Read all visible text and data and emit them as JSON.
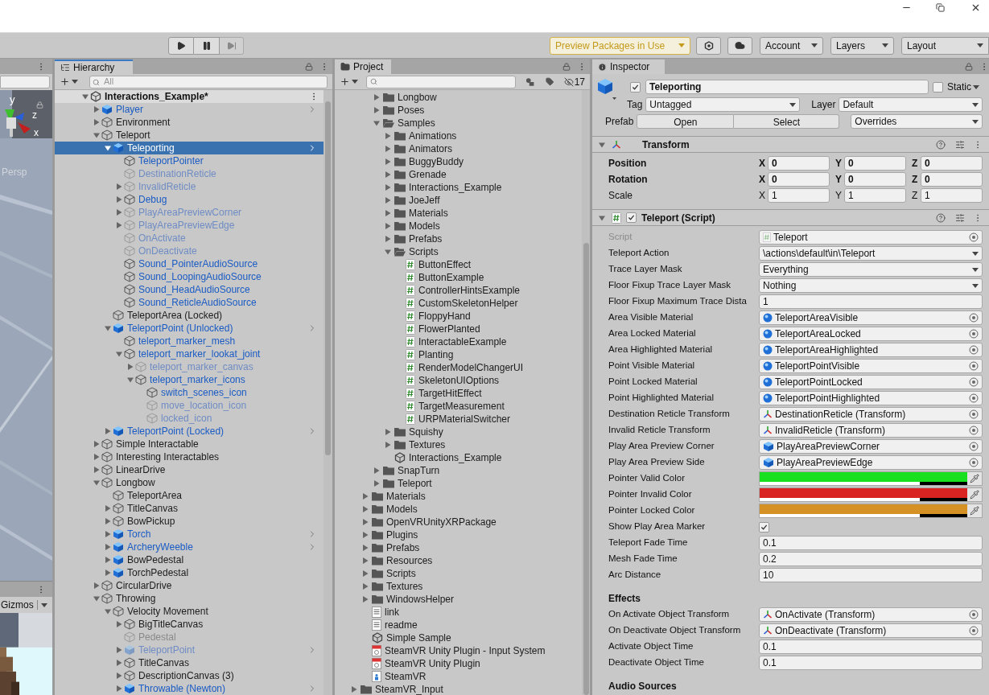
{
  "toolbar": {
    "preview_packages": "Preview Packages in Use",
    "dropdowns": [
      "Account",
      "Layers",
      "Layout"
    ]
  },
  "scene": {
    "view_label": "Persp",
    "axes": [
      "y",
      "z",
      "x"
    ]
  },
  "game": {
    "gizmos": "Gizmos"
  },
  "hierarchy": {
    "title": "Hierarchy",
    "search": {
      "placeholder": "All"
    },
    "scene": {
      "label": "Interactions_Example*",
      "expanded": true
    },
    "tree": [
      {
        "label": "Player",
        "kind": "prefab",
        "selected": false,
        "active": true,
        "expanded": false
      },
      {
        "label": "Environment",
        "kind": "object",
        "selected": false,
        "active": true,
        "expanded": false
      },
      {
        "label": "Teleport",
        "kind": "object",
        "selected": false,
        "active": true,
        "expanded": true,
        "children": [
          {
            "label": "Teleporting",
            "kind": "prefab",
            "selected": true,
            "active": true,
            "expanded": true,
            "children": [
              {
                "label": "TeleportPointer",
                "kind": "part",
                "selected": false,
                "active": true
              },
              {
                "label": "DestinationReticle",
                "kind": "part",
                "selected": false,
                "active": false
              },
              {
                "label": "InvalidReticle",
                "kind": "part",
                "selected": false,
                "active": false,
                "expanded": false
              },
              {
                "label": "Debug",
                "kind": "part",
                "selected": false,
                "active": true,
                "expanded": false
              },
              {
                "label": "PlayAreaPreviewCorner",
                "kind": "part",
                "selected": false,
                "active": false,
                "expanded": false
              },
              {
                "label": "PlayAreaPreviewEdge",
                "kind": "part",
                "selected": false,
                "active": false,
                "expanded": false
              },
              {
                "label": "OnActivate",
                "kind": "part",
                "selected": false,
                "active": false
              },
              {
                "label": "OnDeactivate",
                "kind": "part",
                "selected": false,
                "active": false
              },
              {
                "label": "Sound_PointerAudioSource",
                "kind": "part",
                "selected": false,
                "active": true
              },
              {
                "label": "Sound_LoopingAudioSource",
                "kind": "part",
                "selected": false,
                "active": true
              },
              {
                "label": "Sound_HeadAudioSource",
                "kind": "part",
                "selected": false,
                "active": true
              },
              {
                "label": "Sound_ReticleAudioSource",
                "kind": "part",
                "selected": false,
                "active": true
              }
            ]
          },
          {
            "label": "TeleportArea (Locked)",
            "kind": "object",
            "selected": false,
            "active": true
          },
          {
            "label": "TeleportPoint (Unlocked)",
            "kind": "prefab",
            "selected": false,
            "active": true,
            "expanded": true,
            "children": [
              {
                "label": "teleport_marker_mesh",
                "kind": "part",
                "selected": false,
                "active": true
              },
              {
                "label": "teleport_marker_lookat_joint",
                "kind": "part",
                "selected": false,
                "active": true,
                "expanded": true,
                "children": [
                  {
                    "label": "teleport_marker_canvas",
                    "kind": "part",
                    "selected": false,
                    "active": false,
                    "expanded": false
                  },
                  {
                    "label": "teleport_marker_icons",
                    "kind": "part",
                    "selected": false,
                    "active": true,
                    "expanded": true,
                    "children": [
                      {
                        "label": "switch_scenes_icon",
                        "kind": "part",
                        "selected": false,
                        "active": true
                      },
                      {
                        "label": "move_location_icon",
                        "kind": "part",
                        "selected": false,
                        "active": false
                      },
                      {
                        "label": "locked_icon",
                        "kind": "part",
                        "selected": false,
                        "active": false
                      }
                    ]
                  }
                ]
              }
            ]
          },
          {
            "label": "TeleportPoint (Locked)",
            "kind": "prefab",
            "selected": false,
            "active": true,
            "expanded": false
          }
        ]
      },
      {
        "label": "Simple Interactable",
        "kind": "object",
        "selected": false,
        "active": true,
        "expanded": false
      },
      {
        "label": "Interesting Interactables",
        "kind": "object",
        "selected": false,
        "active": true,
        "expanded": false
      },
      {
        "label": "LinearDrive",
        "kind": "object",
        "selected": false,
        "active": true,
        "expanded": false
      },
      {
        "label": "Longbow",
        "kind": "object",
        "selected": false,
        "active": true,
        "expanded": true,
        "children": [
          {
            "label": "TeleportArea",
            "kind": "object",
            "selected": false,
            "active": true
          },
          {
            "label": "TitleCanvas",
            "kind": "object",
            "selected": false,
            "active": true,
            "expanded": false
          },
          {
            "label": "BowPickup",
            "kind": "object",
            "selected": false,
            "active": true,
            "expanded": false
          },
          {
            "label": "Torch",
            "kind": "prefab",
            "selected": false,
            "active": true,
            "expanded": false
          },
          {
            "label": "ArcheryWeeble",
            "kind": "prefab",
            "selected": false,
            "active": true,
            "expanded": false
          },
          {
            "label": "BowPedestal",
            "kind": "model",
            "selected": false,
            "active": true,
            "expanded": false
          },
          {
            "label": "TorchPedestal",
            "kind": "model",
            "selected": false,
            "active": true,
            "expanded": false
          }
        ]
      },
      {
        "label": "CircularDrive",
        "kind": "object",
        "selected": false,
        "active": true,
        "expanded": false
      },
      {
        "label": "Throwing",
        "kind": "object",
        "selected": false,
        "active": true,
        "expanded": true,
        "children": [
          {
            "label": "Velocity Movement",
            "kind": "object",
            "selected": false,
            "active": true,
            "expanded": true,
            "children": [
              {
                "label": "BigTitleCanvas",
                "kind": "object",
                "selected": false,
                "active": true,
                "expanded": false
              },
              {
                "label": "Pedestal",
                "kind": "object",
                "selected": false,
                "active": false
              },
              {
                "label": "TeleportPoint",
                "kind": "prefab",
                "selected": false,
                "active": false,
                "expanded": false
              },
              {
                "label": "TitleCanvas",
                "kind": "object",
                "selected": false,
                "active": true,
                "expanded": false
              },
              {
                "label": "DescriptionCanvas (3)",
                "kind": "object",
                "selected": false,
                "active": true,
                "expanded": false
              },
              {
                "label": "Throwable (Newton)",
                "kind": "prefab",
                "selected": false,
                "active": true,
                "expanded": false
              }
            ]
          }
        ]
      }
    ]
  },
  "project": {
    "title": "Project",
    "hidden_count": "17",
    "tree": [
      {
        "children": [
          {
            "children": [
              {
                "label": "Longbow",
                "kind": "folder",
                "expanded": false
              },
              {
                "label": "Poses",
                "kind": "folder",
                "expanded": false
              },
              {
                "label": "Samples",
                "kind": "folder",
                "expanded": true,
                "children": [
                  {
                    "label": "Animations",
                    "kind": "folder",
                    "expanded": false
                  },
                  {
                    "label": "Animators",
                    "kind": "folder",
                    "expanded": false
                  },
                  {
                    "label": "BuggyBuddy",
                    "kind": "folder",
                    "expanded": false
                  },
                  {
                    "label": "Grenade",
                    "kind": "folder",
                    "expanded": false
                  },
                  {
                    "label": "Interactions_Example",
                    "kind": "folder",
                    "expanded": false
                  },
                  {
                    "label": "JoeJeff",
                    "kind": "folder",
                    "expanded": false
                  },
                  {
                    "label": "Materials",
                    "kind": "folder",
                    "expanded": false
                  },
                  {
                    "label": "Models",
                    "kind": "folder",
                    "expanded": false
                  },
                  {
                    "label": "Prefabs",
                    "kind": "folder",
                    "expanded": false
                  },
                  {
                    "label": "Scripts",
                    "kind": "folder",
                    "expanded": true,
                    "children": [
                      {
                        "label": "ButtonEffect",
                        "kind": "script"
                      },
                      {
                        "label": "ButtonExample",
                        "kind": "script"
                      },
                      {
                        "label": "ControllerHintsExample",
                        "kind": "script"
                      },
                      {
                        "label": "CustomSkeletonHelper",
                        "kind": "script"
                      },
                      {
                        "label": "FloppyHand",
                        "kind": "script"
                      },
                      {
                        "label": "FlowerPlanted",
                        "kind": "script"
                      },
                      {
                        "label": "InteractableExample",
                        "kind": "script"
                      },
                      {
                        "label": "Planting",
                        "kind": "script"
                      },
                      {
                        "label": "RenderModelChangerUI",
                        "kind": "script"
                      },
                      {
                        "label": "SkeletonUIOptions",
                        "kind": "script"
                      },
                      {
                        "label": "TargetHitEffect",
                        "kind": "script"
                      },
                      {
                        "label": "TargetMeasurement",
                        "kind": "script"
                      },
                      {
                        "label": "URPMaterialSwitcher",
                        "kind": "script"
                      }
                    ]
                  },
                  {
                    "label": "Squishy",
                    "kind": "folder",
                    "expanded": false
                  },
                  {
                    "label": "Textures",
                    "kind": "folder",
                    "expanded": false
                  },
                  {
                    "label": "Interactions_Example",
                    "kind": "scene"
                  }
                ]
              },
              {
                "label": "SnapTurn",
                "kind": "folder",
                "expanded": false
              },
              {
                "label": "Teleport",
                "kind": "folder",
                "expanded": false
              }
            ]
          },
          {
            "label": "Materials",
            "kind": "folder",
            "expanded": false
          },
          {
            "label": "Models",
            "kind": "folder",
            "expanded": false
          },
          {
            "label": "OpenVRUnityXRPackage",
            "kind": "folder",
            "expanded": false
          },
          {
            "label": "Plugins",
            "kind": "folder",
            "expanded": false
          },
          {
            "label": "Prefabs",
            "kind": "folder",
            "expanded": false
          },
          {
            "label": "Resources",
            "kind": "folder",
            "expanded": false
          },
          {
            "label": "Scripts",
            "kind": "folder",
            "expanded": false
          },
          {
            "label": "Textures",
            "kind": "folder",
            "expanded": false
          },
          {
            "label": "WindowsHelper",
            "kind": "folder",
            "expanded": false
          },
          {
            "label": "link",
            "kind": "text"
          },
          {
            "label": "readme",
            "kind": "text"
          },
          {
            "label": "Simple Sample",
            "kind": "scene"
          },
          {
            "label": "SteamVR Unity Plugin - Input System",
            "kind": "pdf"
          },
          {
            "label": "SteamVR Unity Plugin",
            "kind": "pdf"
          },
          {
            "label": "SteamVR",
            "kind": "asset"
          }
        ]
      },
      {
        "label": "SteamVR_Input",
        "kind": "folder",
        "expanded": false
      }
    ]
  },
  "inspector": {
    "title": "Inspector",
    "object": {
      "name": "Teleporting",
      "enabled": true,
      "static": false,
      "static_label": "Static",
      "tag_label": "Tag",
      "tag": "Untagged",
      "layer_label": "Layer",
      "layer": "Default",
      "prefab_label": "Prefab",
      "prefab_buttons": [
        "Open",
        "Select"
      ],
      "overrides": "Overrides"
    },
    "components": [
      {
        "kind": "transform",
        "title": "Transform",
        "expanded": true,
        "rows": [
          {
            "label": "Position",
            "overridden": true,
            "values": [
              {
                "axis": "X",
                "value": "0"
              },
              {
                "axis": "Y",
                "value": "0"
              },
              {
                "axis": "Z",
                "value": "0"
              }
            ]
          },
          {
            "label": "Rotation",
            "overridden": true,
            "values": [
              {
                "axis": "X",
                "value": "0"
              },
              {
                "axis": "Y",
                "value": "0"
              },
              {
                "axis": "Z",
                "value": "0"
              }
            ]
          },
          {
            "label": "Scale",
            "overridden": false,
            "values": [
              {
                "axis": "X",
                "value": "1"
              },
              {
                "axis": "Y",
                "value": "1"
              },
              {
                "axis": "Z",
                "value": "1"
              }
            ]
          }
        ]
      },
      {
        "kind": "script",
        "title": "Teleport (Script)",
        "expanded": true,
        "enabled": true,
        "properties": [
          {
            "kind": "script",
            "label": "Script",
            "value": "Teleport"
          },
          {
            "kind": "dropdown",
            "label": "Teleport Action",
            "value": "\\actions\\default\\in\\Teleport"
          },
          {
            "kind": "dropdown",
            "label": "Trace Layer Mask",
            "value": "Everything"
          },
          {
            "kind": "dropdown",
            "label": "Floor Fixup Trace Layer Mask",
            "value": "Nothing"
          },
          {
            "kind": "number",
            "label": "Floor Fixup Maximum Trace Dista",
            "value": "1"
          },
          {
            "kind": "material",
            "label": "Area Visible Material",
            "value": "TeleportAreaVisible"
          },
          {
            "kind": "material",
            "label": "Area Locked Material",
            "value": "TeleportAreaLocked"
          },
          {
            "kind": "material",
            "label": "Area Highlighted Material",
            "value": "TeleportAreaHighlighted"
          },
          {
            "kind": "material",
            "label": "Point Visible Material",
            "value": "TeleportPointVisible"
          },
          {
            "kind": "material",
            "label": "Point Locked Material",
            "value": "TeleportPointLocked"
          },
          {
            "kind": "material",
            "label": "Point Highlighted Material",
            "value": "TeleportPointHighlighted"
          },
          {
            "kind": "transform",
            "label": "Destination Reticle Transform",
            "value": "DestinationReticle (Transform)"
          },
          {
            "kind": "transform",
            "label": "Invalid Reticle Transform",
            "value": "InvalidReticle (Transform)"
          },
          {
            "kind": "prefab",
            "label": "Play Area Preview Corner",
            "value": "PlayAreaPreviewCorner"
          },
          {
            "kind": "prefab",
            "label": "Play Area Preview Side",
            "value": "PlayAreaPreviewEdge"
          },
          {
            "kind": "color",
            "label": "Pointer Valid Color",
            "color": "#19e01e",
            "level": 0.77
          },
          {
            "kind": "color",
            "label": "Pointer Invalid Color",
            "color": "#d92323",
            "level": 0.77
          },
          {
            "kind": "color",
            "label": "Pointer Locked Color",
            "color": "#d69125",
            "level": 0.77
          },
          {
            "kind": "checkbox",
            "label": "Show Play Area Marker",
            "checked": true
          },
          {
            "kind": "number",
            "label": "Teleport Fade Time",
            "value": "0.1"
          },
          {
            "kind": "number",
            "label": "Mesh Fade Time",
            "value": "0.2"
          },
          {
            "kind": "number",
            "label": "Arc Distance",
            "value": "10"
          },
          {
            "kind": "header",
            "label": "Effects"
          },
          {
            "kind": "transform",
            "label": "On Activate Object Transform",
            "value": "OnActivate (Transform)"
          },
          {
            "kind": "transform",
            "label": "On Deactivate Object Transform",
            "value": "OnDeactivate (Transform)"
          },
          {
            "kind": "number",
            "label": "Activate Object Time",
            "value": "0.1"
          },
          {
            "kind": "number",
            "label": "Deactivate Object Time",
            "value": "0.1"
          },
          {
            "kind": "header",
            "label": "Audio Sources"
          }
        ]
      }
    ]
  }
}
